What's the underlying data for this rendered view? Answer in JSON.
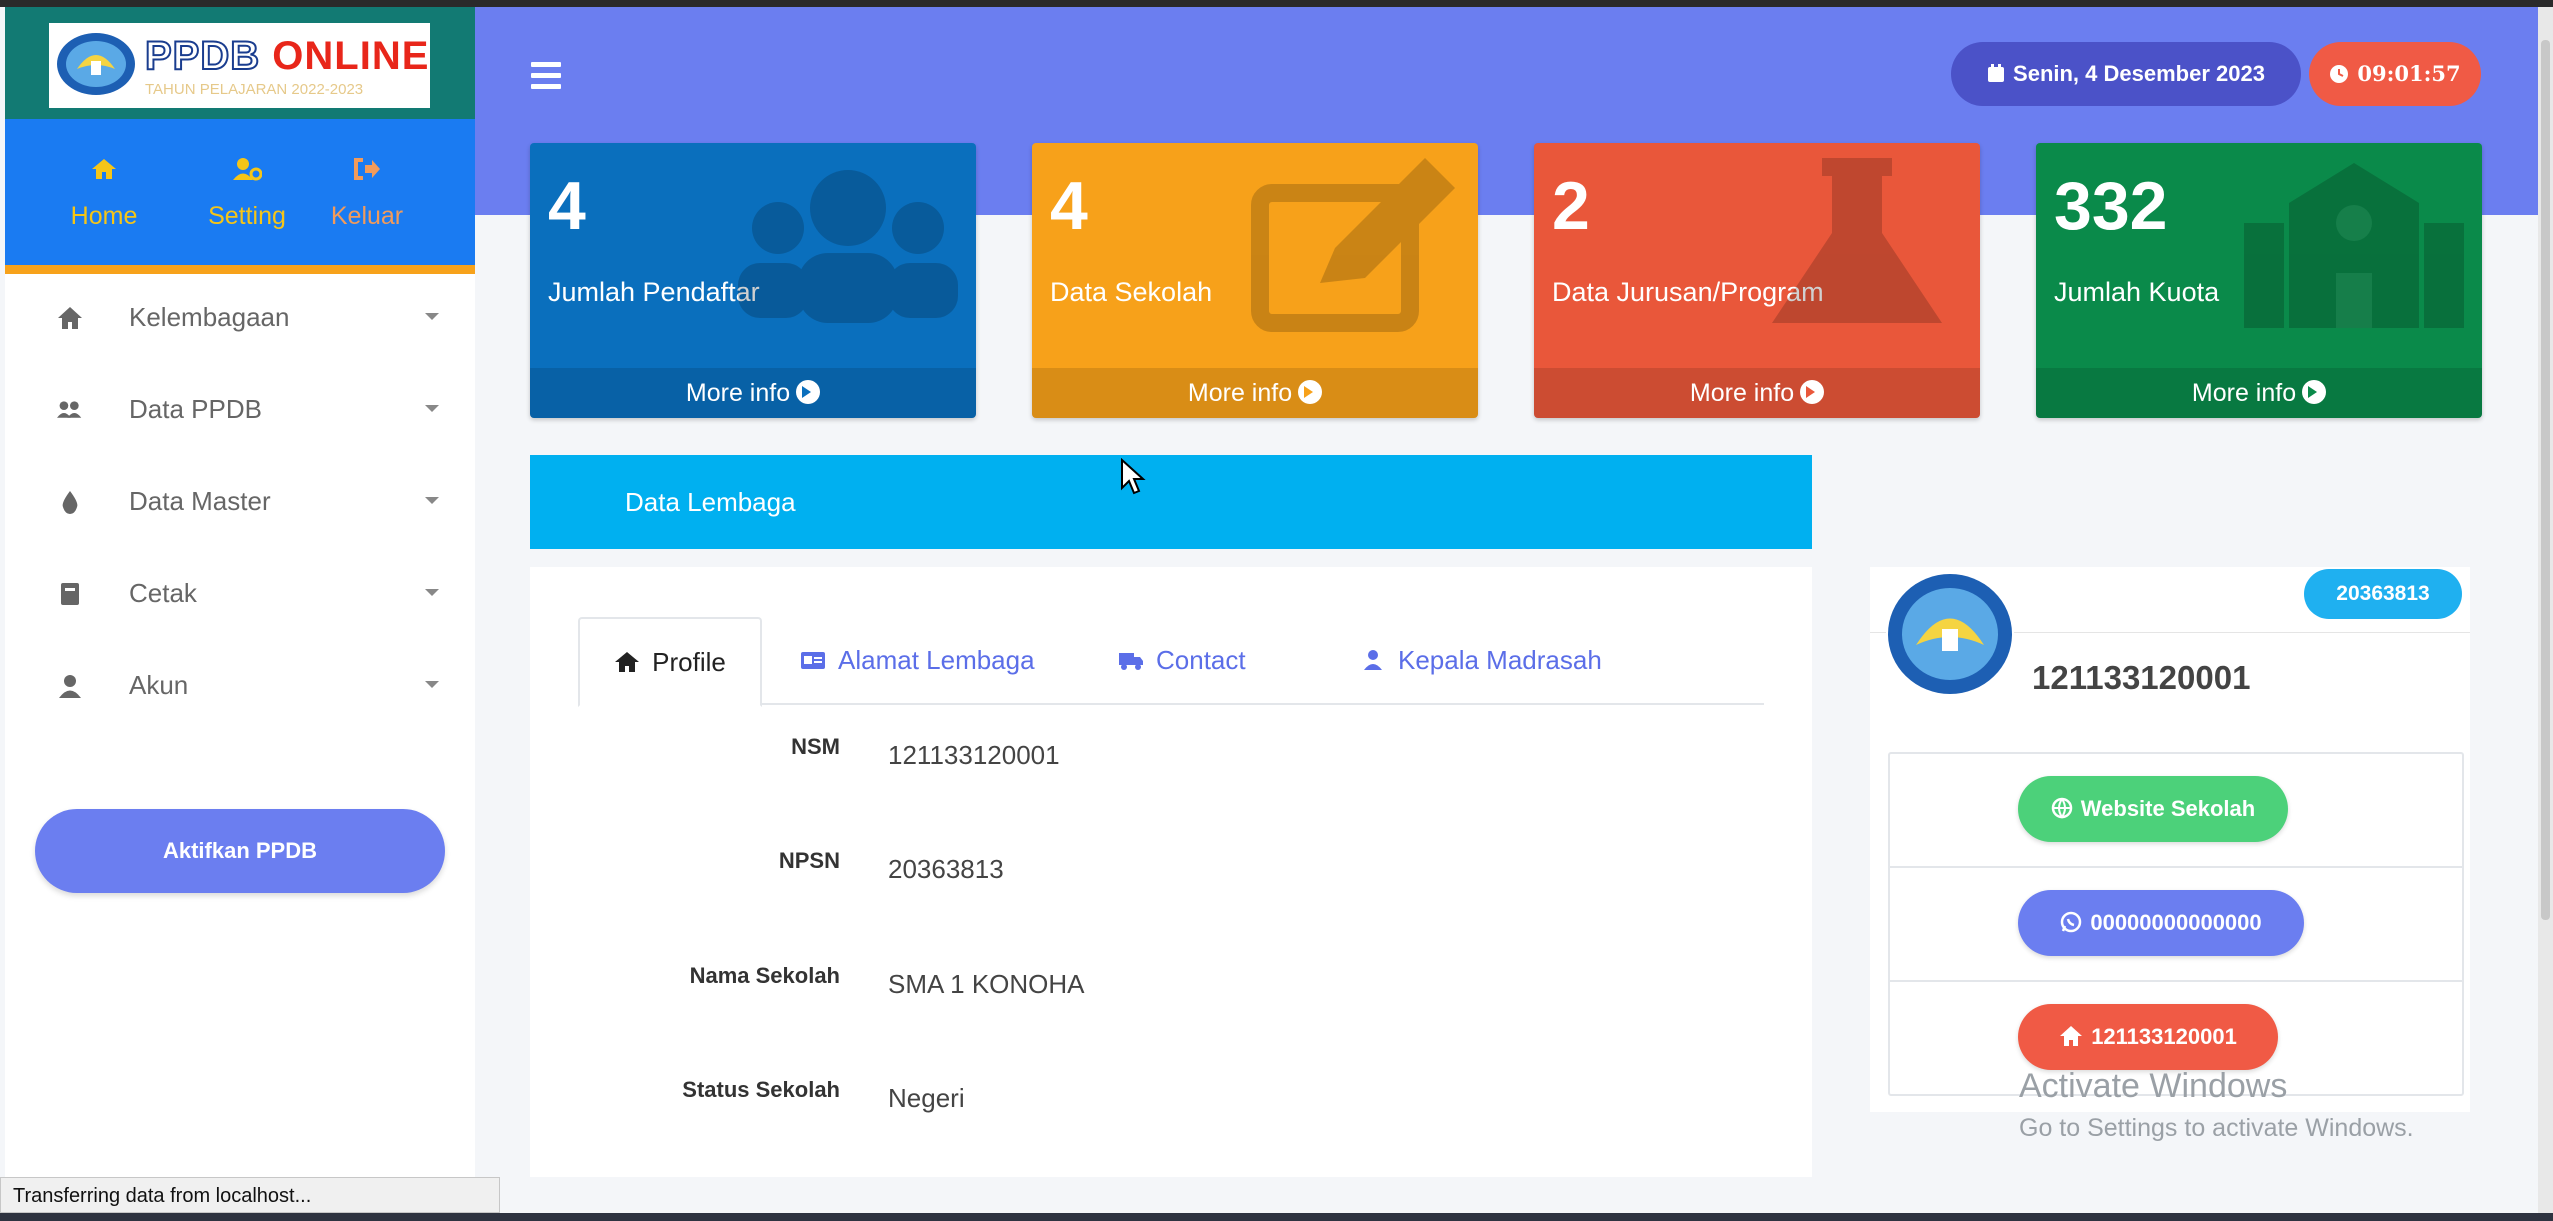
{
  "sidebar": {
    "logo": {
      "title_part1": "PPDB",
      "title_part2": "ONLINE",
      "subtitle": "TAHUN PELAJARAN 2022-2023"
    },
    "top_nav": [
      {
        "label": "Home",
        "icon": "home-icon"
      },
      {
        "label": "Setting",
        "icon": "user-cog-icon"
      },
      {
        "label": "Keluar",
        "icon": "sign-out-icon"
      }
    ],
    "menu": [
      {
        "label": "Kelembagaan",
        "icon": "home-icon"
      },
      {
        "label": "Data PPDB",
        "icon": "users-icon"
      },
      {
        "label": "Data Master",
        "icon": "drop-icon"
      },
      {
        "label": "Cetak",
        "icon": "book-icon"
      },
      {
        "label": "Akun",
        "icon": "user-icon"
      }
    ],
    "activate_button": "Aktifkan PPDB"
  },
  "header": {
    "date": "Senin, 4 Desember 2023",
    "time": "09:01:57"
  },
  "stats": [
    {
      "value": "4",
      "label": "Jumlah Pendaftar",
      "more": "More info",
      "color": "#0a6fbd"
    },
    {
      "value": "4",
      "label": "Data Sekolah",
      "more": "More info",
      "color": "#f7a11a"
    },
    {
      "value": "2",
      "label": "Data Jurusan/Program",
      "more": "More info",
      "color": "#e9573a"
    },
    {
      "value": "332",
      "label": "Jumlah Kuota",
      "more": "More info",
      "color": "#0a8a4a"
    }
  ],
  "lembaga": {
    "title": "Data Lembaga",
    "tabs": [
      {
        "label": "Profile",
        "icon": "home-icon"
      },
      {
        "label": "Alamat Lembaga",
        "icon": "id-card-icon"
      },
      {
        "label": "Contact",
        "icon": "truck-icon"
      },
      {
        "label": "Kepala Madrasah",
        "icon": "user-icon"
      }
    ],
    "fields": [
      {
        "label": "NSM",
        "value": "121133120001"
      },
      {
        "label": "NPSN",
        "value": "20363813"
      },
      {
        "label": "Nama Sekolah",
        "value": "SMA 1 KONOHA"
      },
      {
        "label": "Status Sekolah",
        "value": "Negeri"
      }
    ]
  },
  "side_card": {
    "npsn_badge": "20363813",
    "nsm": "121133120001",
    "website_button": "Website Sekolah",
    "phone_button": "00000000000000",
    "nsm_button": "121133120001",
    "colors": {
      "website": "#4cd17a",
      "phone": "#6b7ef0",
      "nsm": "#f05a45"
    }
  },
  "watermark": {
    "title": "Activate Windows",
    "subtitle": "Go to Settings to activate Windows."
  },
  "status_bar": "Transferring data from localhost..."
}
